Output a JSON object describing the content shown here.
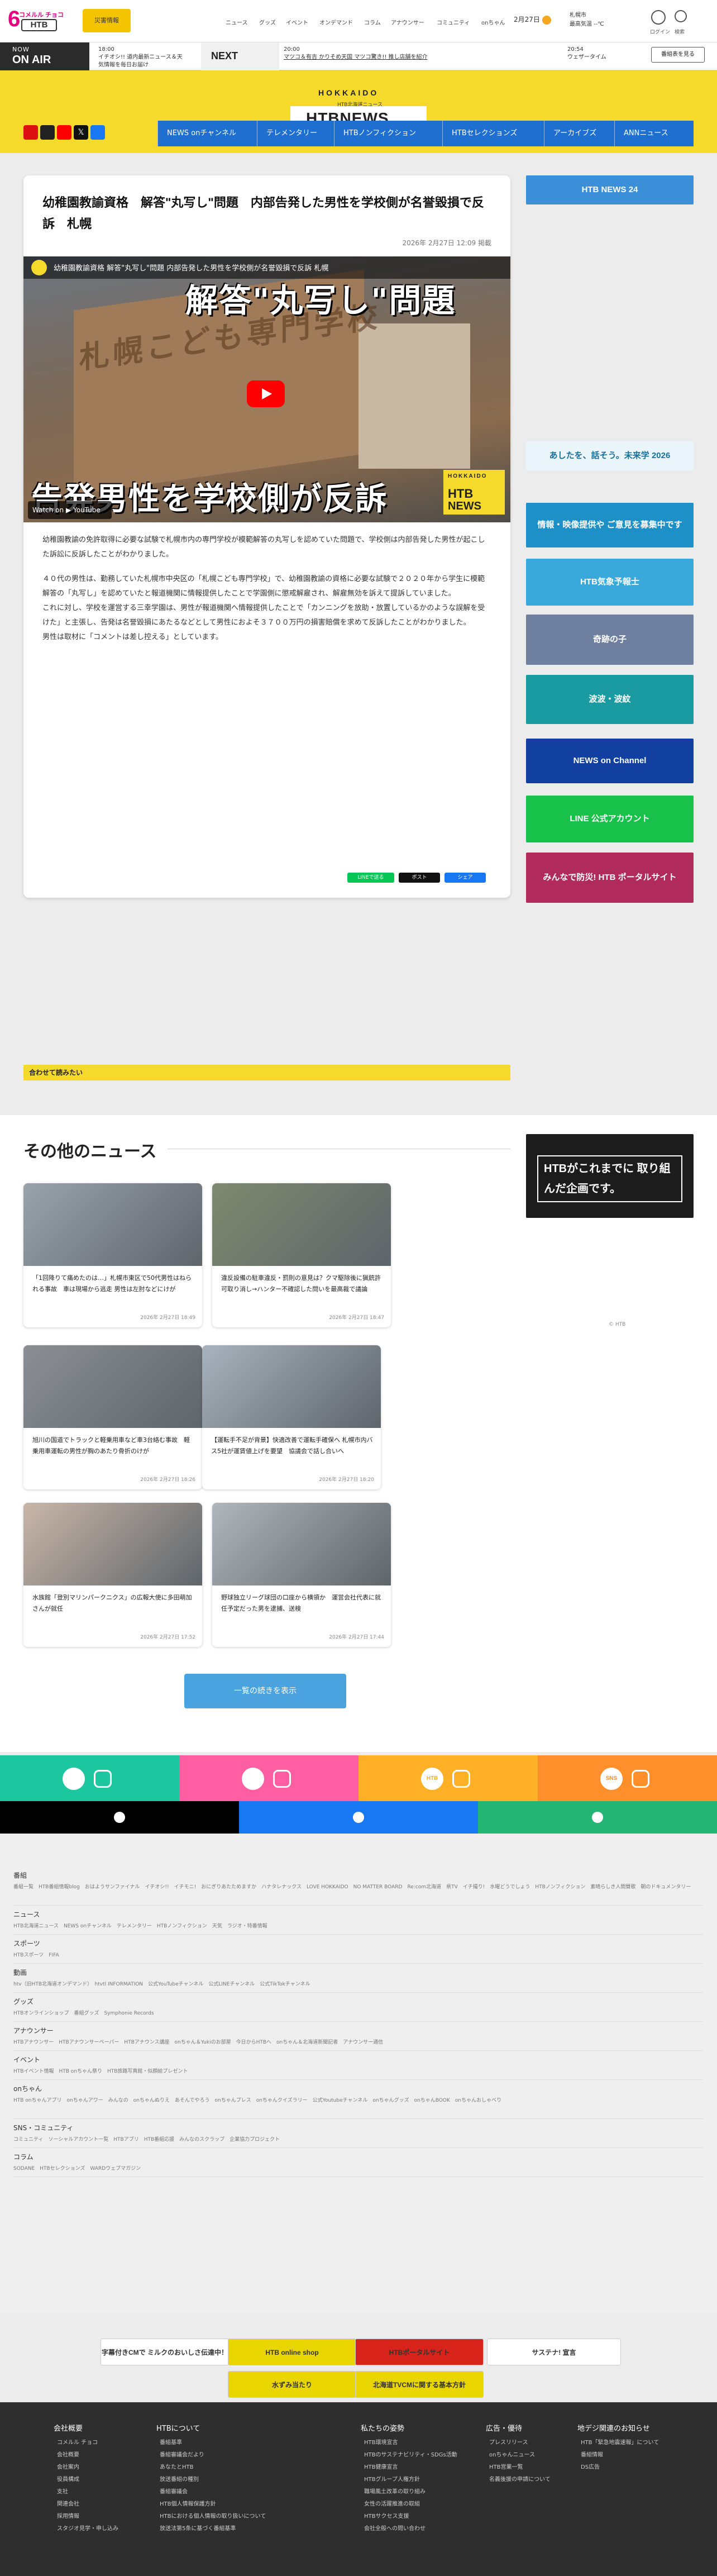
{
  "top": {
    "logo_kick": "コメルル チョコ",
    "logo": "HTB",
    "weather_button": "災害情報",
    "nav": [
      "ニュース",
      "グッズ",
      "イベント",
      "オンデマンド",
      "コラム",
      "アナウンサー",
      "コミュニティ",
      "onちゃん"
    ],
    "date": "2月27日",
    "place_line1": "札幌市",
    "place_line2": "最高気温 --℃",
    "login": "ログイン",
    "search": "検索"
  },
  "onair": {
    "now_small": "NOW",
    "now_big": "ON AIR",
    "now_time": "18:00",
    "now_title": "イチオシ!! 道内最新ニュース＆天気情報を毎日お届け",
    "next_label": "NEXT",
    "next_time": "20:00",
    "next_title": "マツコ＆有吉 かりそめ天国 マツコ驚き!! 推し店舗を紹介",
    "after_time": "20:54",
    "after_title": "ウェザータイム",
    "guide_button": "番組表を見る"
  },
  "header": {
    "hokkaido": "HOKKAIDO",
    "sub": "HTB北海道ニュース",
    "title": "HTBNEWS",
    "nav": [
      "NEWS onチャンネル",
      "テレメンタリー",
      "HTBノンフィクション",
      "HTBセレクションズ",
      "アーカイブズ",
      "ANNニュース"
    ]
  },
  "article": {
    "title": "幼稚園教諭資格　解答\"丸写し\"問題　内部告発した男性を学校側が名誉毀損で反訴　札幌",
    "date": "2026年 2月27日 12:09 掲載",
    "video_channel": "幼稚園教諭資格 解答\"丸写し\"問題 内部告発した男性を学校側が名誉毀損で反訴 札幌",
    "video_top_caption": "解答\"丸写し\"問題",
    "video_bottom_caption": "告発男性を学校側が反訴",
    "video_sign": "札幌こども専門学校",
    "badge_top": "HOKKAIDO",
    "badge_mid": "HTB",
    "badge_bot": "NEWS",
    "watch_on": "Watch on ▶ YouTube",
    "paragraphs": [
      "幼稚園教諭の免許取得に必要な試験で札幌市内の専門学校が模範解答の丸写しを認めていた問題で、学校側は内部告発した男性が起こした訴訟に反訴したことがわかりました。",
      "",
      "４０代の男性は、勤務していた札幌市中央区の「札幌こども専門学校」で、幼稚園教諭の資格に必要な試験で２０２０年から学生に模範解答の「丸写し」を認めていたと報道機関に情報提供したことで学園側に懲戒解雇され、解雇無効を訴えて提訴していました。",
      "これに対し、学校を運営する三幸学園は、男性が報道機関へ情報提供したことで「カンニングを放助・放置しているかのような誤解を受けた」と主張し、告発は名誉毀損にあたるなどとして男性におよそ３７００万円の損害賠償を求めて反訴したことがわかりました。",
      "男性は取材に「コメントは差し控える」としています。"
    ],
    "share_line": "LINEで送る",
    "share_x": "ポスト",
    "share_fb": "シェア"
  },
  "right_banners": [
    {
      "label": "HTB NEWS 24",
      "color": "#3b8fd9"
    },
    {
      "label": "あしたを、話そう。未来学 2026",
      "color": "#eaf6fb"
    },
    {
      "label": "情報・映像提供や ご意見を募集中です",
      "color": "#1e90c8"
    },
    {
      "label": "HTB気象予報士",
      "color": "#39a9dc"
    },
    {
      "label": "奇跡の子",
      "color": "#6e7fa0"
    },
    {
      "label": "波波・波紋",
      "color": "#1a9ba1"
    },
    {
      "label": "NEWS on Channel",
      "color": "#1240a0"
    },
    {
      "label": "LINE 公式アカウント",
      "color": "#18c14a"
    },
    {
      "label": "みんなで防災! HTB ポータルサイト",
      "color": "#b02a5a"
    }
  ],
  "related_label": "合わせて読みたい",
  "other": {
    "title": "その他のニュース",
    "ad_text": "HTBがこれまでに 取り組んだ企画です。",
    "ad_caption": "© HTB",
    "cards": [
      {
        "title": "「1回降りて痛めたのは…」札幌市東区で50代男性はねられる事故　車は現場から逃走 男性は左肘などにけが",
        "date": "2026年 2月27日 18:49",
        "color": "#9aa3ab"
      },
      {
        "title": "違反設備の駐車違反・罰則の意見は？クマ駆除後に猟銃許可取り消し→ハンター不確認した問いを最高裁で議論",
        "date": "2026年 2月27日 18:47",
        "color": "#7d8a6f"
      },
      {
        "title": "旭川の国道でトラックと軽乗用車など車3台絡む事故　軽乗用車運転の男性が胸のあたり骨折のけが",
        "date": "2026年 2月27日 18:26",
        "color": "#8b8f93"
      },
      {
        "title": "【運転手不足が背景】快適改善で運転手確保へ 札幌市内バス5社が運賃値上げを要望　協議会で話し合いへ",
        "date": "2026年 2月27日 18:20",
        "color": "#a8b3bd"
      },
      {
        "title": "水族館「登別マリンパークニクス」の広報大使に多田萌加さんが就任",
        "date": "2026年 2月27日 17:52",
        "color": "#c9b6a8"
      },
      {
        "title": "野球独立リーグ球団の口座から横領か　運営会社代表に就任予定だった男を逮捕、送検",
        "date": "2026年 2月27日 17:44",
        "color": "#b0b6bb"
      }
    ],
    "more_button": "一覧の続きを表示"
  },
  "footer_bars": {
    "colors": [
      "#1cc7a0",
      "#ff5fa2",
      "#ffb027",
      "#ff8f2a"
    ],
    "labels": [
      "",
      "",
      "HTB",
      "SNS"
    ],
    "social_colors": [
      "#000000",
      "#1877f2",
      "#22b573"
    ]
  },
  "sitemap": [
    {
      "head": "番組",
      "links": "番組一覧　HTB番組情報blog　おはようサンファイナル　イチオシ!!　イチモニ!　おにぎりあたためますか　ハナタレナックス　LOVE HOKKAIDO　NO MATTER BOARD　Re:com北海道　県TV　イチ撮り!　水曜どうでしょう　HTBノンフィクション　素晴らしき人間賛歌　朝のドキュメンタリー"
    },
    {
      "head": "ニュース",
      "links": "HTB北海道ニュース　NEWS onチャンネル　テレメンタリー　HTBノンフィクション　天気　ラジオ・特番情報"
    },
    {
      "head": "スポーツ",
      "links": "HTBスポーツ　FIFA"
    },
    {
      "head": "動画",
      "links": "htv（旧HTB北海道オンデマンド）　htvtl INFORMATION　公式YouTubeチャンネル　公式LINEチャンネル　公式TikTokチャンネル"
    },
    {
      "head": "グッズ",
      "links": "HTBオンラインショップ　番組グッズ　Symphonie Records"
    },
    {
      "head": "アナウンサー",
      "links": "HTBアナウンサー　HTBアナウンサーペーパー　HTBアナウンス講座　onちゃん＆Yukiのお部屋　今日からHTBへ　onちゃん＆北海道新聞記者　アナウンサー通信"
    },
    {
      "head": "イベント",
      "links": "HTBイベント情報　HTB onちゃん祭り　HTB旅路写真館・似顔絵プレゼント"
    },
    {
      "head": "onちゃん",
      "links": "HTB onちゃんアプリ　onちゃんアワー　みんなの　onちゃんぬりえ　あそんでやろう　onちゃんプレス　onちゃんクイズラリー　公式Youtubeチャンネル　onちゃんグッズ　onちゃんBOOK　onちゃんおしゃべり"
    },
    {
      "head": "SNS・コミュニティ",
      "links": "コミュニティ　ソーシャルアカウント一覧　HTBアプリ　HTB番組応援　みんなのスクラップ　企業協力プロジェクト"
    },
    {
      "head": "コラム",
      "links": "SODANE　HTBセレクションズ　WARDウェブマガジン"
    }
  ],
  "bottom_banners": [
    {
      "label": "字幕付きCMで ミルクのおいしさ伝達中！",
      "color": "#ffffff"
    },
    {
      "label": "HTB online shop",
      "color": "#e9d500"
    },
    {
      "label": "HTBポータルサイト",
      "color": "#d7231a"
    },
    {
      "label": "サステナ! 宣言",
      "color": "#ffffff"
    },
    {
      "label": "水ずみ当たり",
      "color": "#e9d500"
    },
    {
      "label": "北海道TVCMに関する基本方針",
      "color": "#e9d500"
    }
  ],
  "dark_footer": {
    "cols": [
      {
        "head": "会社概要",
        "links": [
          "コメルル チョコ",
          "会社概要",
          "会社案内",
          "役員構成",
          "支社",
          "関連会社",
          "採用情報",
          "スタジオ見学・申し込み"
        ]
      },
      {
        "head": "HTBについて",
        "links": [
          "番組基準",
          "番組審議会だより",
          "あなたとHTB",
          "放送番組の種別",
          "番組審議会",
          "HTB個人情報保護方針",
          "HTBにおける個人情報の取り扱いについて",
          "放送法第5条に基づく番組基準"
        ]
      },
      {
        "head": "私たちの姿勢",
        "links": [
          "HTB環境宣言",
          "HTBのサステナビリティ・SDGs活動",
          "HTB健康宣言",
          "HTBグループ人権方針",
          "職場風土改革の取り組み",
          "女性の活躍推進の取組",
          "HTBサクセス支援",
          "会社全般への問い合わせ"
        ]
      },
      {
        "head": "広告・優待",
        "links": [
          "プレスリリース",
          "onちゃんニュース",
          "HTB営業一覧",
          "名義後援の申請について"
        ]
      },
      {
        "head": "地デジ関連のお知らせ",
        "links": [
          "HTB「緊急地震速報」について",
          "番組情報",
          "DS広告"
        ]
      }
    ]
  }
}
